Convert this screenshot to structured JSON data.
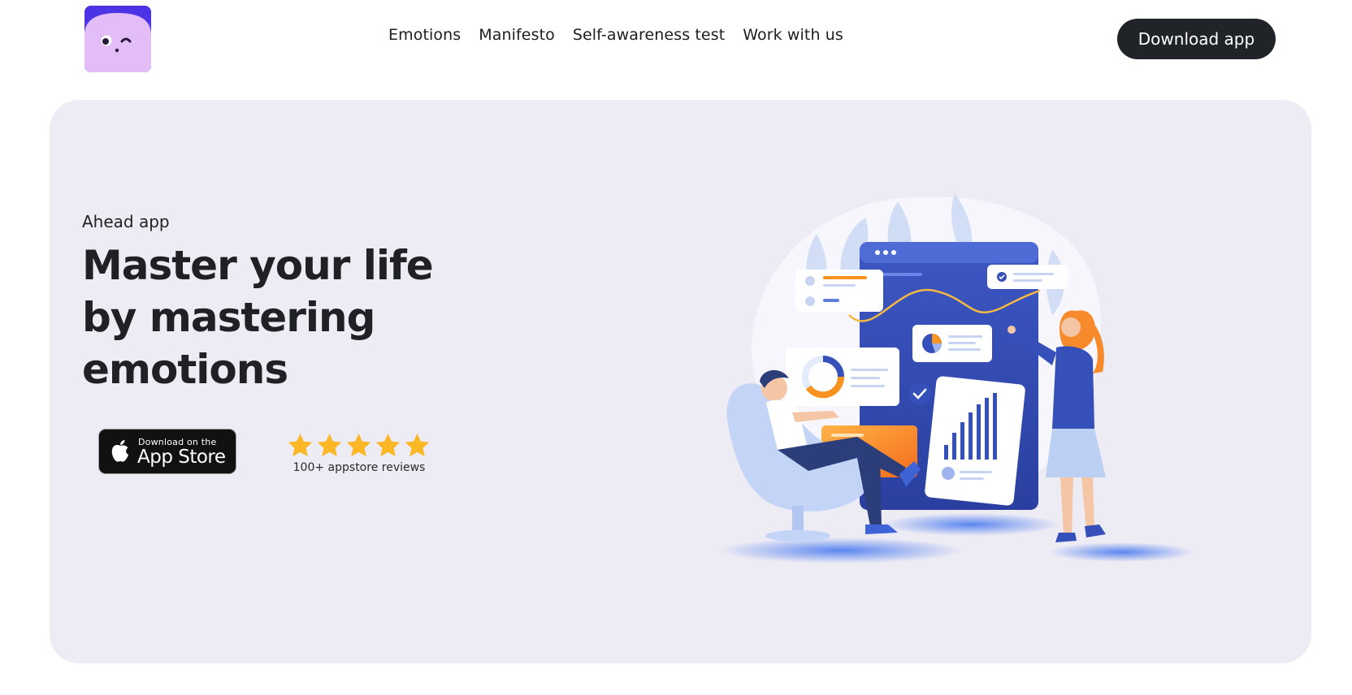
{
  "header": {
    "nav": [
      "Emotions",
      "Manifesto",
      "Self-awareness test",
      "Work with us"
    ],
    "download_label": "Download app"
  },
  "hero": {
    "eyebrow": "Ahead app",
    "headline": "Master your life\nby mastering\nemotions",
    "appstore": {
      "small": "Download on the",
      "big": "App Store"
    },
    "rating": {
      "stars": 5,
      "label": "100+ appstore reviews"
    }
  },
  "colors": {
    "brand_purple": "#4c33e6",
    "logo_face": "#e2bdf7",
    "hero_bg": "#edebf4",
    "button_dark": "#202327",
    "star": "#fbb725",
    "illustration_blue": "#3550b8",
    "illustration_orange": "#f7931e"
  },
  "icons": [
    "logo-face",
    "apple-icon",
    "star-icon",
    "check-icon",
    "pie-chart-icon",
    "donut-chart-icon",
    "bar-chart-icon"
  ]
}
